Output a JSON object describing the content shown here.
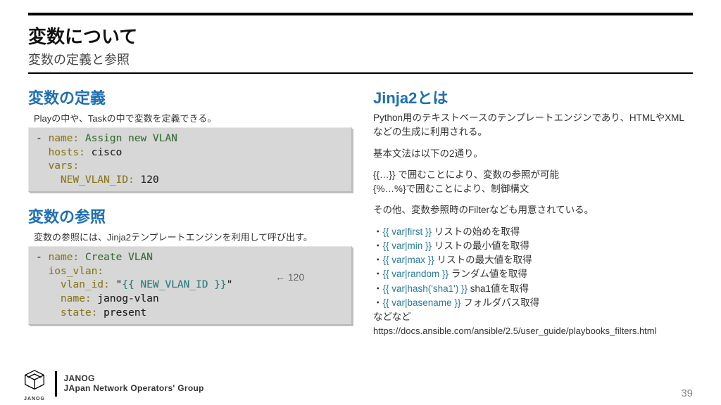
{
  "header": {
    "title": "変数について",
    "subtitle": "変数の定義と参照"
  },
  "left": {
    "section1": {
      "heading": "変数の定義",
      "desc": "Playの中や、Taskの中で変数を定義できる。",
      "code": {
        "l1a": "- ",
        "l1b": "name:",
        "l1c": " Assign new VLAN",
        "l2a": "  ",
        "l2b": "hosts:",
        "l2c": " cisco",
        "l3a": "  ",
        "l3b": "vars:",
        "l4a": "    ",
        "l4b": "NEW_VLAN_ID:",
        "l4c": " 120"
      }
    },
    "section2": {
      "heading": "変数の参照",
      "desc": "変数の参照には、Jinja2テンプレートエンジンを利用して呼び出す。",
      "code": {
        "l1a": "- ",
        "l1b": "name:",
        "l1c": " Create VLAN",
        "l2a": "  ",
        "l2b": "ios_vlan:",
        "l3a": "    ",
        "l3b": "vlan_id:",
        "l3c": " \"",
        "l3d": "{{ NEW_VLAN_ID }}",
        "l3e": "\"",
        "l4a": "    ",
        "l4b": "name:",
        "l4c": " janog-vlan",
        "l5a": "    ",
        "l5b": "state:",
        "l5c": " present"
      },
      "arrow": "← 120"
    }
  },
  "right": {
    "heading": "Jinja2とは",
    "p1": "Python用のテキストベースのテンプレートエンジンであり、HTMLやXMLなどの生成に利用される。",
    "p2": "基本文法は以下の2通り。",
    "p3a": "{{…}} で囲むことにより、変数の参照が可能",
    "p3b": "{%…%}で囲むことにより、制御構文",
    "p4": "その他、変数参照時のFilterなども用意されている。",
    "filters": [
      {
        "expr": "{{ var|first }}",
        "txt": " リストの始めを取得"
      },
      {
        "expr": "{{ var|min }}",
        "txt": " リストの最小値を取得"
      },
      {
        "expr": "{{ var|max }}",
        "txt": " リストの最大値を取得"
      },
      {
        "expr": "{{ var|random }}",
        "txt": " ランダム値を取得"
      },
      {
        "expr": "{{ var|hash('sha1') }}",
        "txt": " sha1値を取得"
      },
      {
        "expr": "{{ var|basename }}",
        "txt": " フォルダパス取得"
      }
    ],
    "p5": "などなど",
    "url": "https://docs.ansible.com/ansible/2.5/user_guide/playbooks_filters.html"
  },
  "footer": {
    "logo_top": "JANOG",
    "logo_bot": "JApan Network Operators' Group",
    "logo_under": "JANOG",
    "page": "39"
  }
}
